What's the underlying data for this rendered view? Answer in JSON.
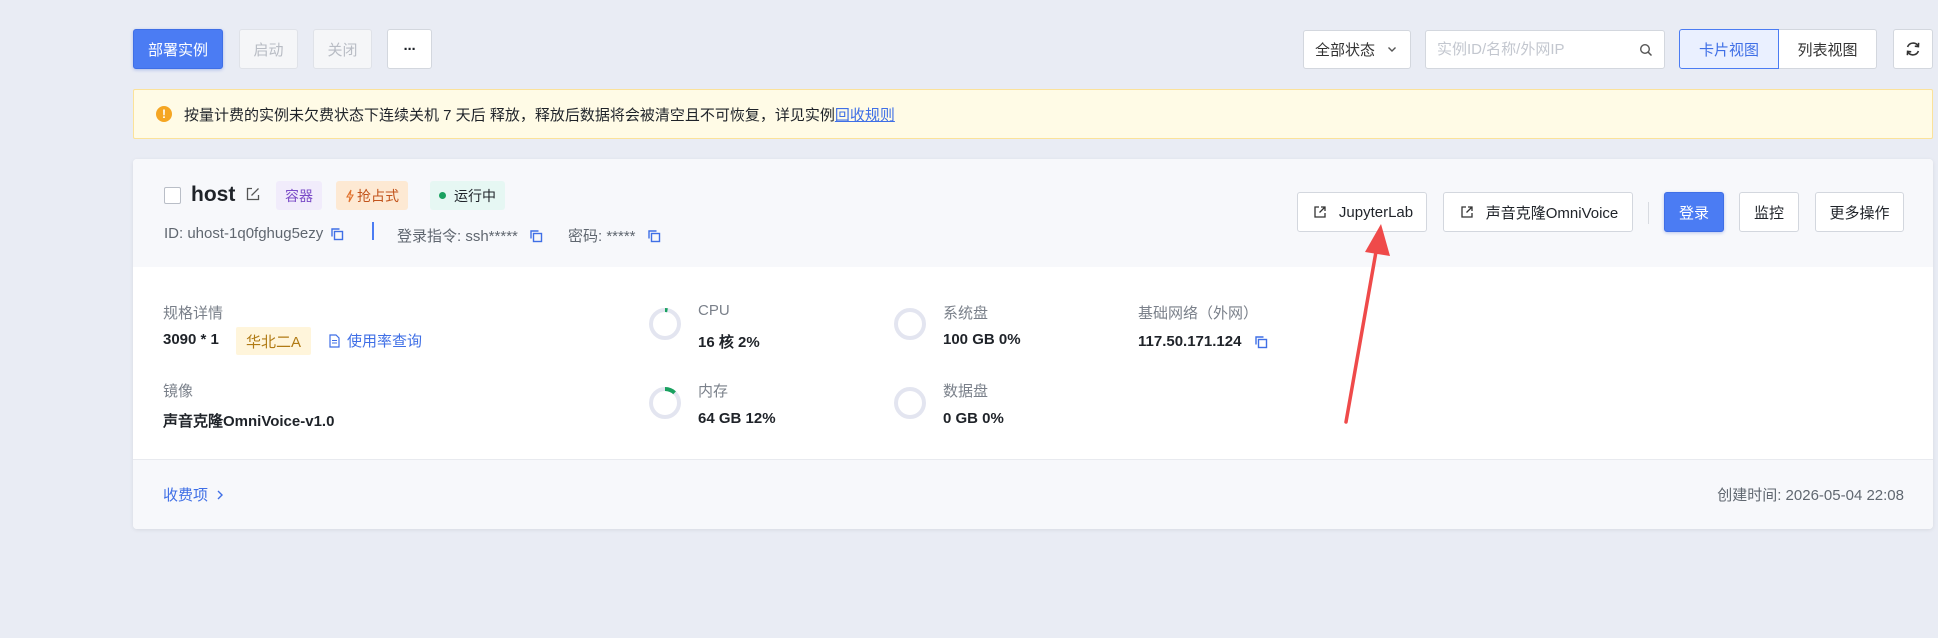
{
  "toolbar": {
    "deploy_label": "部署实例",
    "start_label": "启动",
    "shutdown_label": "关闭",
    "more_label": "···",
    "status_filter": "全部状态",
    "search_placeholder": "实例ID/名称/外网IP",
    "card_view_label": "卡片视图",
    "list_view_label": "列表视图"
  },
  "notice": {
    "text": "按量计费的实例未欠费状态下连续关机 7 天后 释放，释放后数据将会被清空且不可恢复，详见实例",
    "link_text": "回收规则"
  },
  "instance": {
    "name": "host",
    "tags": {
      "type": "容器",
      "billing": "抢占式",
      "status": "运行中"
    },
    "id_text": "ID: uhost-1q0fghug5ezy",
    "login_cmd_text": "登录指令: ssh*****",
    "password_text": "密码: *****",
    "actions": {
      "jupyter": "JupyterLab",
      "omnivoice": "声音克隆OmniVoice",
      "login": "登录",
      "monitor": "监控",
      "more_ops": "更多操作"
    },
    "spec": {
      "label": "规格详情",
      "value": "3090 * 1",
      "region": "华北二A",
      "usage_link": "使用率查询"
    },
    "image": {
      "label": "镜像",
      "value": "声音克隆OmniVoice-v1.0"
    },
    "cpu": {
      "label": "CPU",
      "value": "16 核 2%",
      "usage": 0.02
    },
    "memory": {
      "label": "内存",
      "value": "64 GB 12%",
      "usage": 0.12
    },
    "system_disk": {
      "label": "系统盘",
      "value": "100 GB 0%",
      "usage": 0
    },
    "data_disk": {
      "label": "数据盘",
      "value": "0 GB 0%",
      "usage": 0
    },
    "network": {
      "label": "基础网络（外网）",
      "ip": "117.50.171.124"
    },
    "fee_link": "收费项",
    "created_text": "创建时间: 2026-05-04 22:08"
  },
  "colors": {
    "primary": "#4b7cf3",
    "success": "#19a15f",
    "warning": "#f5a623",
    "annotation_arrow": "#ef4a4a"
  }
}
